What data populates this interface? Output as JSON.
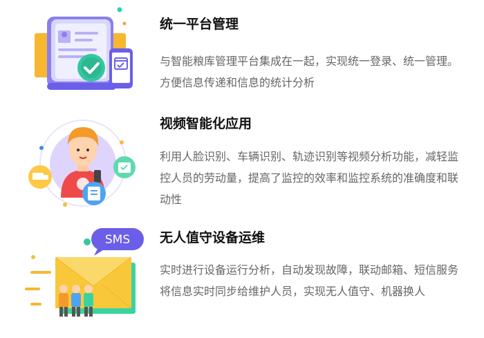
{
  "features": [
    {
      "title": "统一平台管理",
      "description": "与智能粮库管理平台集成在一起，实现统一登录、统一管理。方便信息传递和信息的统计分析",
      "icons": [
        "document-icon",
        "check-circle-icon",
        "mobile-calendar-icon"
      ],
      "colors": {
        "accent": "#6b5ee8",
        "check": "#36c5a0",
        "document": "#f8c146"
      }
    },
    {
      "title": "视频智能化应用",
      "description": "利用人脸识别、车辆识别、轨迹识别等视频分析功能，减轻监控人员的劳动量，提高了监控的效率和监控系统的准确度和联动性",
      "icons": [
        "person-icon",
        "truck-icon",
        "calendar-check-icon",
        "document-list-icon"
      ],
      "colors": {
        "accent": "#ffb84d",
        "shirt": "#ef4a4a",
        "ring": "#e3d9fb"
      }
    },
    {
      "title": "无人值守设备运维",
      "description": "实时进行设备运行分析，自动发现故障，联动邮箱、短信服务将信息实时同步给维护人员，实现无人值守、机器换人",
      "icons": [
        "sms-bubble-icon",
        "envelope-icon",
        "people-group-icon"
      ],
      "badge": "SMS",
      "colors": {
        "envelope": "#f9c83a",
        "bubble": "#6b5ee8",
        "base": "#3ad3a0"
      }
    }
  ]
}
